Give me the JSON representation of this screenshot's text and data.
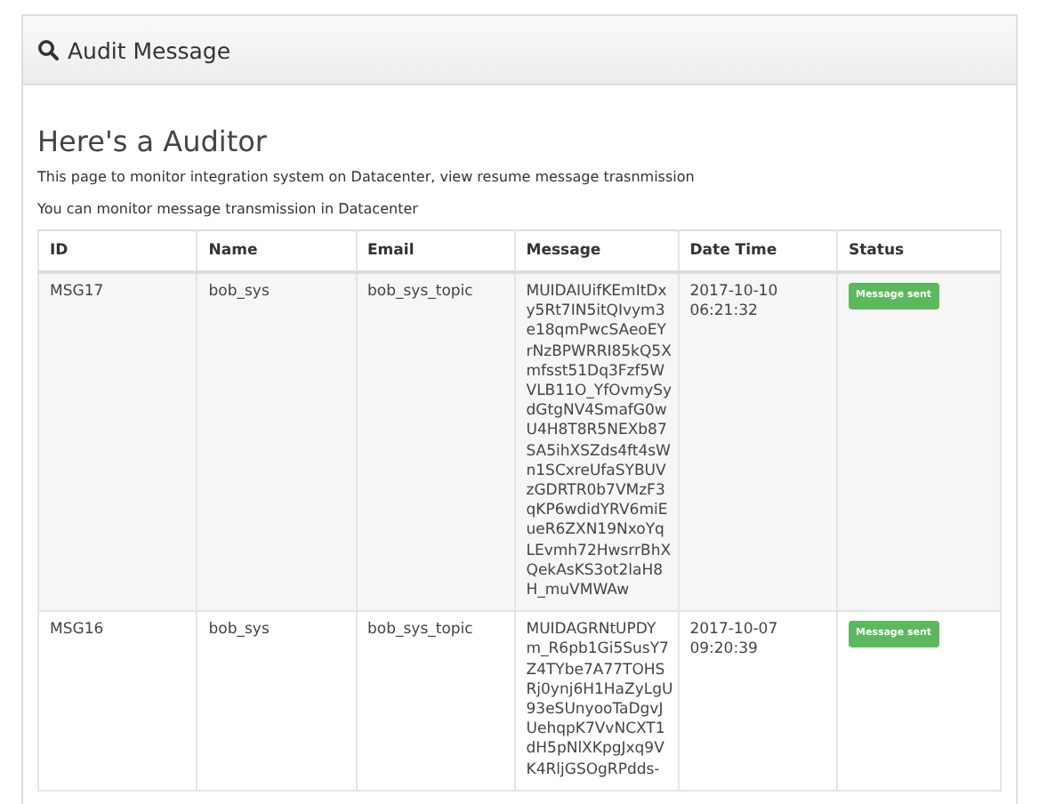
{
  "panel": {
    "title": "Audit Message"
  },
  "heading": "Here's a Auditor",
  "descriptions": [
    "This page to monitor integration system on Datacenter, view resume message trasnmission",
    "You can monitor message transmission in Datacenter"
  ],
  "table": {
    "columns": [
      "ID",
      "Name",
      "Email",
      "Message",
      "Date Time",
      "Status"
    ],
    "rows": [
      {
        "id": "MSG17",
        "name": "bob_sys",
        "email": "bob_sys_topic",
        "message": "MUIDAIUifKEmItDx\ny5Rt7IN5itQIvym3\ne18qmPwcSAeoEY\nrNzBPWRRI85kQ5X\nmfsst51Dq3Fzf5W\nVLB11O_YfOvmySy\ndGtgNV4SmafG0w\nU4H8T8R5NEXb87\nSA5ihXSZds4ft4sW\nn1SCxreUfaSYBUV\nzGDRTR0b7VMzF3\nqKP6wdidYRV6miE\nueR6ZXN19NxoYq\nLEvmh72HwsrrBhX\nQekAsKS3ot2laH8\nH_muVMWAw",
        "datetime": "2017-10-10\n06:21:32",
        "status": "Message sent",
        "kind": "sent"
      },
      {
        "id": "MSG16",
        "name": "bob_sys",
        "email": "bob_sys_topic",
        "message": "MUIDAGRNtUPDY\nm_R6pb1Gi5SusY7\nZ4TYbe7A77TOHS\nRj0ynj6H1HaZyLgU\n93eSUnyooTaDgvJ\nUehqpK7VvNCXT1\ndH5pNlXKpgJxq9V\nK4RljGSOgRPdds-",
        "datetime": "2017-10-07\n09:20:39",
        "status": "Message sent",
        "kind": "sent"
      }
    ]
  }
}
